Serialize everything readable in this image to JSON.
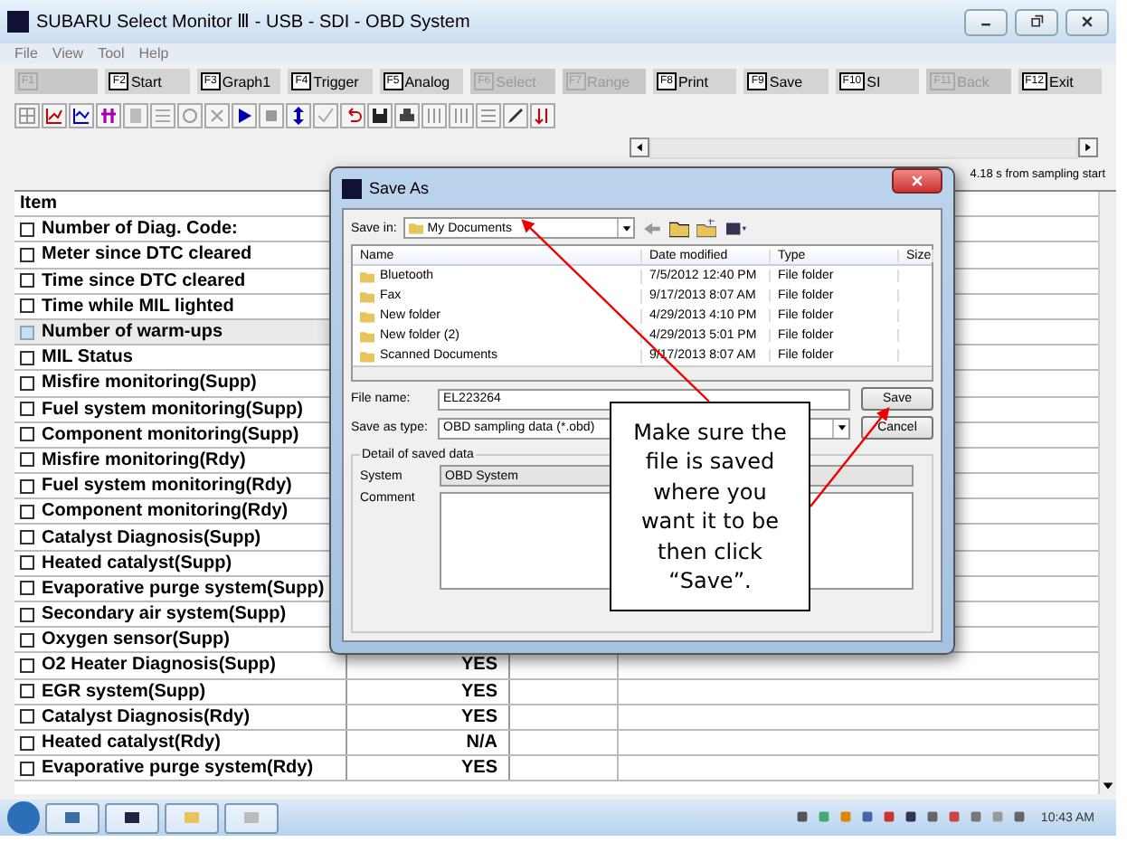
{
  "window": {
    "title": "SUBARU Select Monitor Ⅲ - USB - SDI - OBD System"
  },
  "menu": [
    "File",
    "View",
    "Tool",
    "Help"
  ],
  "function_keys": [
    {
      "key": "F1",
      "disabled": true
    },
    {
      "key": "F2",
      "label": "Start",
      "disabled": false
    },
    {
      "key": "F3",
      "label": "Graph1",
      "disabled": false
    },
    {
      "key": "F4",
      "label": "Trigger",
      "disabled": false
    },
    {
      "key": "F5",
      "label": "Analog",
      "disabled": false
    },
    {
      "key": "F6",
      "label": "Select",
      "disabled": true
    },
    {
      "key": "F7",
      "label": "Range",
      "disabled": true
    },
    {
      "key": "F8",
      "label": "Print",
      "disabled": false
    },
    {
      "key": "F9",
      "label": "Save",
      "disabled": false
    },
    {
      "key": "F10",
      "label": "SI",
      "disabled": false
    },
    {
      "key": "F11",
      "label": "Back",
      "disabled": true
    },
    {
      "key": "F12",
      "label": "Exit",
      "disabled": false
    }
  ],
  "status_text": "4.18 s from sampling start",
  "table": {
    "header": "Item",
    "rows": [
      {
        "item": "Number of Diag. Code:",
        "selected": false
      },
      {
        "item": "Meter since DTC cleared",
        "selected": false
      },
      {
        "item": "Time since DTC cleared",
        "selected": false
      },
      {
        "item": "Time while MIL lighted",
        "selected": false
      },
      {
        "item": "Number of warm-ups",
        "selected": true
      },
      {
        "item": "MIL Status",
        "selected": false
      },
      {
        "item": "Misfire monitoring(Supp)",
        "selected": false
      },
      {
        "item": "Fuel system monitoring(Supp)",
        "selected": false
      },
      {
        "item": "Component monitoring(Supp)",
        "selected": false
      },
      {
        "item": "Misfire monitoring(Rdy)",
        "selected": false
      },
      {
        "item": "Fuel system monitoring(Rdy)",
        "selected": false
      },
      {
        "item": "Component monitoring(Rdy)",
        "selected": false
      },
      {
        "item": "Catalyst Diagnosis(Supp)",
        "selected": false
      },
      {
        "item": "Heated catalyst(Supp)",
        "selected": false
      },
      {
        "item": "Evaporative purge system(Supp)",
        "selected": false
      },
      {
        "item": "Secondary air system(Supp)",
        "selected": false
      },
      {
        "item": "Oxygen sensor(Supp)",
        "selected": false
      },
      {
        "item": "O2 Heater Diagnosis(Supp)",
        "selected": false,
        "value": "YES"
      },
      {
        "item": "EGR system(Supp)",
        "selected": false,
        "value": "YES"
      },
      {
        "item": "Catalyst Diagnosis(Rdy)",
        "selected": false,
        "value": "YES"
      },
      {
        "item": "Heated catalyst(Rdy)",
        "selected": false,
        "value": "N/A"
      },
      {
        "item": "Evaporative purge system(Rdy)",
        "selected": false,
        "value": "YES"
      }
    ]
  },
  "dialog": {
    "title": "Save As",
    "save_in_label": "Save in:",
    "save_in": "My Documents",
    "columns": [
      "Name",
      "Date modified",
      "Type",
      "Size"
    ],
    "files": [
      {
        "name": "Bluetooth",
        "date": "7/5/2012 12:40 PM",
        "type": "File folder"
      },
      {
        "name": "Fax",
        "date": "9/17/2013 8:07 AM",
        "type": "File folder"
      },
      {
        "name": "New folder",
        "date": "4/29/2013 4:10 PM",
        "type": "File folder"
      },
      {
        "name": "New folder (2)",
        "date": "4/29/2013 5:01 PM",
        "type": "File folder"
      },
      {
        "name": "Scanned Documents",
        "date": "9/17/2013 8:07 AM",
        "type": "File folder"
      }
    ],
    "file_name_label": "File name:",
    "file_name": "EL223264",
    "type_label": "Save as type:",
    "type_value": "OBD sampling data (*.obd)",
    "buttons": [
      "Save",
      "Cancel"
    ],
    "group_title": "Detail of saved data",
    "system_label": "System",
    "system_value": "OBD System",
    "comment_label": "Comment"
  },
  "callout": "Make sure the file is saved where you want it to be then click “Save”.",
  "taskbar": {
    "clock": "10:43 AM"
  }
}
